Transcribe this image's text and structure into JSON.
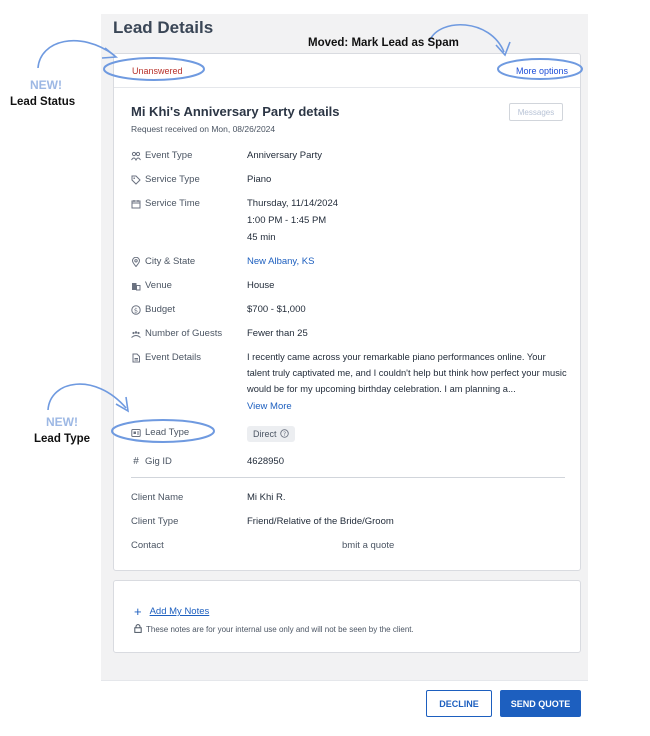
{
  "page": {
    "title": "Lead Details"
  },
  "status_bar": {
    "status": "Unanswered",
    "more_options": "More options"
  },
  "lead": {
    "title": "Mi Khi's Anniversary Party details",
    "received": "Request received on Mon, 08/26/2024",
    "messages_label": "Messages"
  },
  "fields": {
    "event_type": {
      "label": "Event Type",
      "value": "Anniversary Party",
      "icon": "people-icon"
    },
    "service_type": {
      "label": "Service Type",
      "value": "Piano",
      "icon": "tag-icon"
    },
    "service_time": {
      "label": "Service Time",
      "date": "Thursday, 11/14/2024",
      "time": "1:00 PM - 1:45 PM",
      "duration": "45 min",
      "icon": "calendar-icon"
    },
    "city_state": {
      "label": "City & State",
      "value": "New Albany, KS",
      "icon": "location-pin-icon"
    },
    "venue": {
      "label": "Venue",
      "value": "House",
      "icon": "building-icon"
    },
    "budget": {
      "label": "Budget",
      "value": "$700 - $1,000",
      "icon": "dollar-circle-icon"
    },
    "guests": {
      "label": "Number of Guests",
      "value": "Fewer than 25",
      "icon": "group-icon"
    },
    "event_details": {
      "label": "Event Details",
      "value": "I recently came across your remarkable piano performances online. Your talent truly captivated me, and I couldn't help but think how perfect your music would be for my upcoming birthday celebration. I am planning a...",
      "view_more": "View More",
      "icon": "document-icon"
    },
    "lead_type": {
      "label": "Lead Type",
      "value": "Direct",
      "icon": "id-card-icon"
    },
    "gig_id": {
      "label": "Gig ID",
      "value": "4628950",
      "icon": "hash-icon"
    },
    "client_name": {
      "label": "Client Name",
      "value": "Mi Khi R."
    },
    "client_type": {
      "label": "Client Type",
      "value": "Friend/Relative of the Bride/Groom"
    },
    "contact": {
      "label": "Contact",
      "value": "bmit a quote"
    }
  },
  "notes": {
    "add_label": "Add My Notes",
    "hint": "These notes are for your internal use only and will not be seen by the client."
  },
  "footer": {
    "decline": "DECLINE",
    "send_quote": "SEND QUOTE"
  },
  "annotations": {
    "moved": "Moved: Mark Lead as Spam",
    "new_1": "NEW!",
    "lead_status": "Lead Status",
    "new_2": "NEW!",
    "lead_type": "Lead Type"
  },
  "colors": {
    "accent": "#1d5fbf",
    "status_red": "#b8322a",
    "annotation_blue": "#6f9ae0"
  }
}
